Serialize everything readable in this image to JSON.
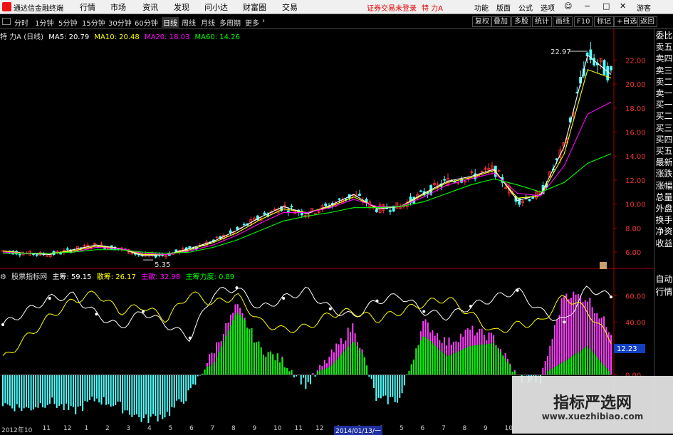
{
  "app": {
    "name": "通达信金融终端"
  },
  "menu": {
    "items": [
      "行情",
      "市场",
      "资讯",
      "发现",
      "问小达",
      "财富圈",
      "交易"
    ],
    "login_notice": "证券交易未登录",
    "stock_name": "特 力A",
    "right_items": [
      "功能",
      "版面",
      "公式",
      "选项"
    ],
    "user": "游客"
  },
  "toolbar": {
    "periods": [
      "分时",
      "1分钟",
      "5分钟",
      "15分钟",
      "30分钟",
      "60分钟",
      "日线",
      "周线",
      "月线",
      "多周期",
      "更多"
    ],
    "active_period": "日线",
    "right_buttons": [
      "复权",
      "叠加",
      "多股",
      "统计",
      "画线",
      "F10",
      "标记",
      "+自选",
      "返回"
    ]
  },
  "main_legend": {
    "title": "特 力A (日线)",
    "ma": [
      {
        "label": "MA5: 20.79",
        "color": "#ffffff"
      },
      {
        "label": "MA10: 20.48",
        "color": "#ffff00"
      },
      {
        "label": "MA20: 18.03",
        "color": "#ff00ff"
      },
      {
        "label": "MA60: 14.26",
        "color": "#00ff00"
      }
    ]
  },
  "indicator_legend": {
    "title": "股票指标网",
    "items": [
      {
        "label": "主筹: 59.15",
        "color": "#ffffff"
      },
      {
        "label": "散筹: 26.17",
        "color": "#ffff00"
      },
      {
        "label": "主散: 32.98",
        "color": "#ff00ff"
      },
      {
        "label": "主筹力度: 0.89",
        "color": "#00ff00"
      }
    ]
  },
  "chart_data": [
    {
      "type": "line",
      "title": "特 力A (日线)",
      "ylim": [
        5,
        23.5
      ],
      "yticks": [
        "22.00",
        "20.00",
        "18.00",
        "16.00",
        "14.00",
        "12.00",
        "10.00",
        "8.00",
        "6.00"
      ],
      "annotations": {
        "high": "22.97",
        "low": "5.35"
      },
      "series": [
        {
          "name": "MA5",
          "color": "#ffffff",
          "values": [
            6.1,
            5.9,
            5.8,
            6.2,
            6.6,
            6.3,
            5.7,
            5.8,
            6.3,
            6.9,
            7.8,
            8.9,
            9.8,
            9.2,
            9.9,
            10.8,
            9.6,
            9.8,
            10.9,
            11.9,
            12.3,
            12.9,
            10.3,
            10.8,
            14.8,
            22.4,
            20.8
          ]
        },
        {
          "name": "MA10",
          "color": "#ffff00",
          "values": [
            6.1,
            5.9,
            5.9,
            6.1,
            6.5,
            6.3,
            5.8,
            5.8,
            6.2,
            6.8,
            7.6,
            8.7,
            9.6,
            9.3,
            9.8,
            10.6,
            9.7,
            9.8,
            10.8,
            11.8,
            12.2,
            12.8,
            10.5,
            10.7,
            14.2,
            21.2,
            20.5
          ]
        },
        {
          "name": "MA20",
          "color": "#ff00ff",
          "values": [
            6.0,
            5.9,
            5.9,
            6.0,
            6.4,
            6.3,
            5.9,
            5.8,
            6.1,
            6.6,
            7.4,
            8.4,
            9.3,
            9.3,
            9.7,
            10.4,
            9.8,
            9.8,
            10.6,
            11.6,
            12.1,
            12.6,
            10.9,
            10.7,
            13.2,
            17.5,
            18.5
          ]
        },
        {
          "name": "MA60",
          "color": "#00ff00",
          "values": [
            5.9,
            5.9,
            5.9,
            6.0,
            6.2,
            6.2,
            6.0,
            5.9,
            6.0,
            6.4,
            7.0,
            7.8,
            8.6,
            9.0,
            9.3,
            9.7,
            9.7,
            9.8,
            10.2,
            10.9,
            11.6,
            12.1,
            11.6,
            11.0,
            11.8,
            13.4,
            14.2
          ]
        }
      ]
    },
    {
      "type": "bar",
      "title": "股票指标网",
      "ylim": [
        -38,
        72
      ],
      "yticks": [
        "60.00",
        "40.00",
        "20.00",
        "0.00"
      ],
      "current_value": "12.23",
      "series": [
        {
          "name": "主筹",
          "color": "#ffffff",
          "values": [
            38,
            48,
            58,
            60,
            46,
            36,
            48,
            38,
            28,
            62,
            66,
            50,
            58,
            64,
            50,
            44,
            56,
            60,
            48,
            44,
            52,
            58,
            64,
            48,
            40,
            66,
            59
          ]
        },
        {
          "name": "散筹",
          "color": "#ffff00",
          "values": [
            12,
            28,
            44,
            56,
            62,
            48,
            52,
            42,
            62,
            54,
            60,
            40,
            34,
            36,
            46,
            48,
            42,
            48,
            54,
            58,
            46,
            32,
            38,
            40,
            60,
            48,
            26
          ]
        },
        {
          "name": "主散",
          "color": "#ff00ff",
          "values": [
            -22,
            -26,
            -20,
            -28,
            -18,
            -24,
            -34,
            -30,
            -14,
            18,
            52,
            20,
            10,
            -8,
            14,
            38,
            -20,
            -18,
            40,
            24,
            34,
            28,
            -2,
            -4,
            62,
            58,
            33
          ]
        },
        {
          "name": "主筹力度",
          "color": "#00ff00",
          "values": [
            0,
            0,
            0,
            0,
            0,
            0,
            0,
            0,
            0,
            8,
            48,
            30,
            12,
            0,
            6,
            26,
            0,
            0,
            30,
            14,
            22,
            24,
            0,
            0,
            10,
            22,
            0.89
          ]
        }
      ]
    }
  ],
  "date_axis": {
    "labels": [
      "2012年10",
      "11",
      "12",
      "1",
      "2",
      "3",
      "4",
      "5",
      "6",
      "7",
      "8",
      "9",
      "10",
      "11",
      "12",
      "1",
      "3",
      "4",
      "5",
      "6",
      "7",
      "8",
      "9",
      "10"
    ],
    "highlight": "2014/01/13/一"
  },
  "side_panel": {
    "items": [
      "委比",
      "卖五",
      "卖四",
      "卖三",
      "卖二",
      "卖一",
      "买一",
      "买二",
      "买三",
      "买四",
      "买五",
      "最新",
      "涨跌",
      "涨幅",
      "总量",
      "外盘",
      "换手",
      "净资",
      "收益"
    ],
    "bottom": [
      "自动",
      "行情"
    ]
  },
  "watermark": {
    "title": "指标严选网",
    "url": "www.xuezhibiao.com"
  }
}
